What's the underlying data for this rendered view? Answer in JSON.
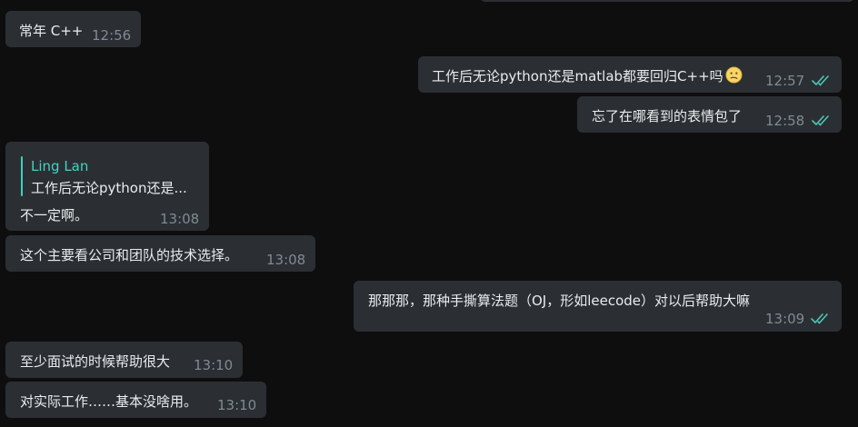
{
  "messages": [
    {
      "text": "常年 C++",
      "time": "12:56",
      "direction": "incoming"
    },
    {
      "text": "工作后无论python还是matlab都要回归C++吗",
      "time": "12:57",
      "direction": "outgoing",
      "emoji": "confused-face-icon",
      "status": "read"
    },
    {
      "text": "忘了在哪看到的表情包了",
      "time": "12:58",
      "direction": "outgoing",
      "status": "read"
    },
    {
      "reply_name": "Ling Lan",
      "reply_text": "工作后无论python还是...",
      "text": "不一定啊。",
      "time": "13:08",
      "direction": "incoming"
    },
    {
      "text": "这个主要看公司和团队的技术选择。",
      "time": "13:08",
      "direction": "incoming"
    },
    {
      "text": "那那那，那种手撕算法题（OJ，形如leecode）对以后帮助大嘛",
      "time": "13:09",
      "direction": "outgoing",
      "status": "read"
    },
    {
      "text": "至少面试的时候帮助很大",
      "time": "13:10",
      "direction": "incoming"
    },
    {
      "text": "对实际工作……基本没啥用。",
      "time": "13:10",
      "direction": "incoming"
    }
  ],
  "colors": {
    "background": "#0e0e0e",
    "bubble": "#2b2f33",
    "text": "#e9ecee",
    "time": "#7f8a93",
    "reply_accent": "#44d3c1",
    "read_ticks": "#4fc3b4"
  }
}
